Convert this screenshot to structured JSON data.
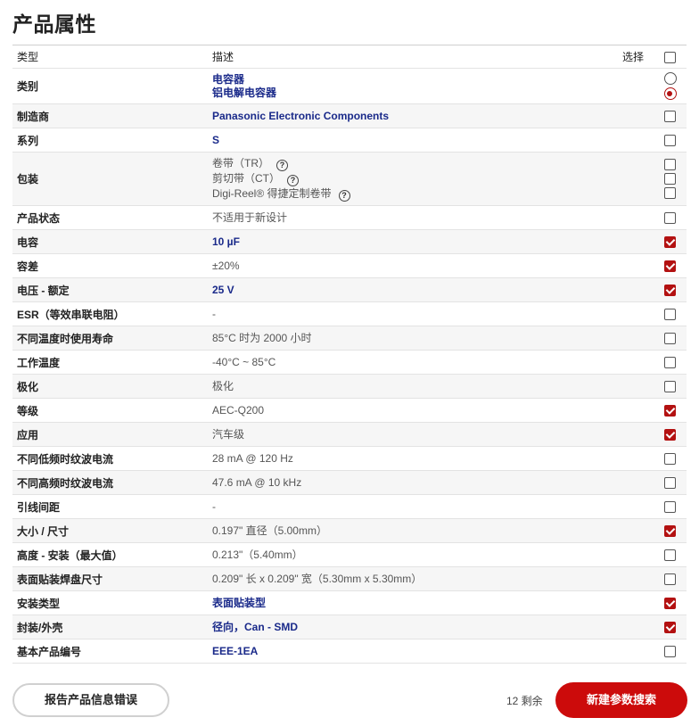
{
  "title": "产品属性",
  "header": {
    "type": "类型",
    "desc": "描述",
    "select": "选择"
  },
  "rows": [
    {
      "type": "类别",
      "values": [
        "电容器",
        "铝电解电容器"
      ],
      "link": true,
      "control": "radio",
      "checked": [
        false,
        true
      ]
    },
    {
      "type": "制造商",
      "values": [
        "Panasonic Electronic Components"
      ],
      "link": true,
      "checked": [
        false
      ]
    },
    {
      "type": "系列",
      "values": [
        "S"
      ],
      "link": true,
      "checked": [
        false
      ]
    },
    {
      "type": "包装",
      "values": [
        "卷带（TR）",
        "剪切带（CT）",
        "Digi-Reel® 得捷定制卷带"
      ],
      "link": false,
      "help": true,
      "checked": [
        false,
        false,
        false
      ]
    },
    {
      "type": "产品状态",
      "values": [
        "不适用于新设计"
      ],
      "link": false,
      "checked": [
        false
      ]
    },
    {
      "type": "电容",
      "values": [
        "10 µF"
      ],
      "link": true,
      "checked": [
        true
      ]
    },
    {
      "type": "容差",
      "values": [
        "±20%"
      ],
      "link": false,
      "checked": [
        true
      ]
    },
    {
      "type": "电压 - 额定",
      "values": [
        "25 V"
      ],
      "link": true,
      "checked": [
        true
      ]
    },
    {
      "type": "ESR（等效串联电阻）",
      "values": [
        "-"
      ],
      "link": false,
      "checked": [
        false
      ]
    },
    {
      "type": "不同温度时使用寿命",
      "values": [
        "85°C 时为 2000 小时"
      ],
      "link": false,
      "checked": [
        false
      ]
    },
    {
      "type": "工作温度",
      "values": [
        "-40°C ~ 85°C"
      ],
      "link": false,
      "checked": [
        false
      ]
    },
    {
      "type": "极化",
      "values": [
        "极化"
      ],
      "link": false,
      "checked": [
        false
      ]
    },
    {
      "type": "等级",
      "values": [
        "AEC-Q200"
      ],
      "link": false,
      "checked": [
        true
      ]
    },
    {
      "type": "应用",
      "values": [
        "汽车级"
      ],
      "link": false,
      "checked": [
        true
      ]
    },
    {
      "type": "不同低频时纹波电流",
      "values": [
        "28 mA @ 120 Hz"
      ],
      "link": false,
      "checked": [
        false
      ]
    },
    {
      "type": "不同高频时纹波电流",
      "values": [
        "47.6 mA @ 10 kHz"
      ],
      "link": false,
      "checked": [
        false
      ]
    },
    {
      "type": "引线间距",
      "values": [
        "-"
      ],
      "link": false,
      "checked": [
        false
      ]
    },
    {
      "type": "大小 / 尺寸",
      "values": [
        "0.197\" 直径（5.00mm）"
      ],
      "link": false,
      "checked": [
        true
      ]
    },
    {
      "type": "高度 - 安装（最大值）",
      "values": [
        "0.213\"（5.40mm）"
      ],
      "link": false,
      "checked": [
        false
      ]
    },
    {
      "type": "表面贴装焊盘尺寸",
      "values": [
        "0.209\" 长 x 0.209\" 宽（5.30mm x 5.30mm）"
      ],
      "link": false,
      "checked": [
        false
      ]
    },
    {
      "type": "安装类型",
      "values": [
        "表面贴装型"
      ],
      "link": true,
      "checked": [
        true
      ]
    },
    {
      "type": "封装/外壳",
      "values": [
        "径向，Can - SMD"
      ],
      "link": true,
      "checked": [
        true
      ]
    },
    {
      "type": "基本产品编号",
      "values": [
        "EEE-1EA"
      ],
      "link": true,
      "checked": [
        false
      ]
    }
  ],
  "footer": {
    "report_label": "报告产品信息错误",
    "remaining": "12 剩余",
    "search_label": "新建参数搜索"
  },
  "colors": {
    "accent": "#cc0b0b",
    "checked": "#b31111",
    "link": "#1a2a8a"
  }
}
